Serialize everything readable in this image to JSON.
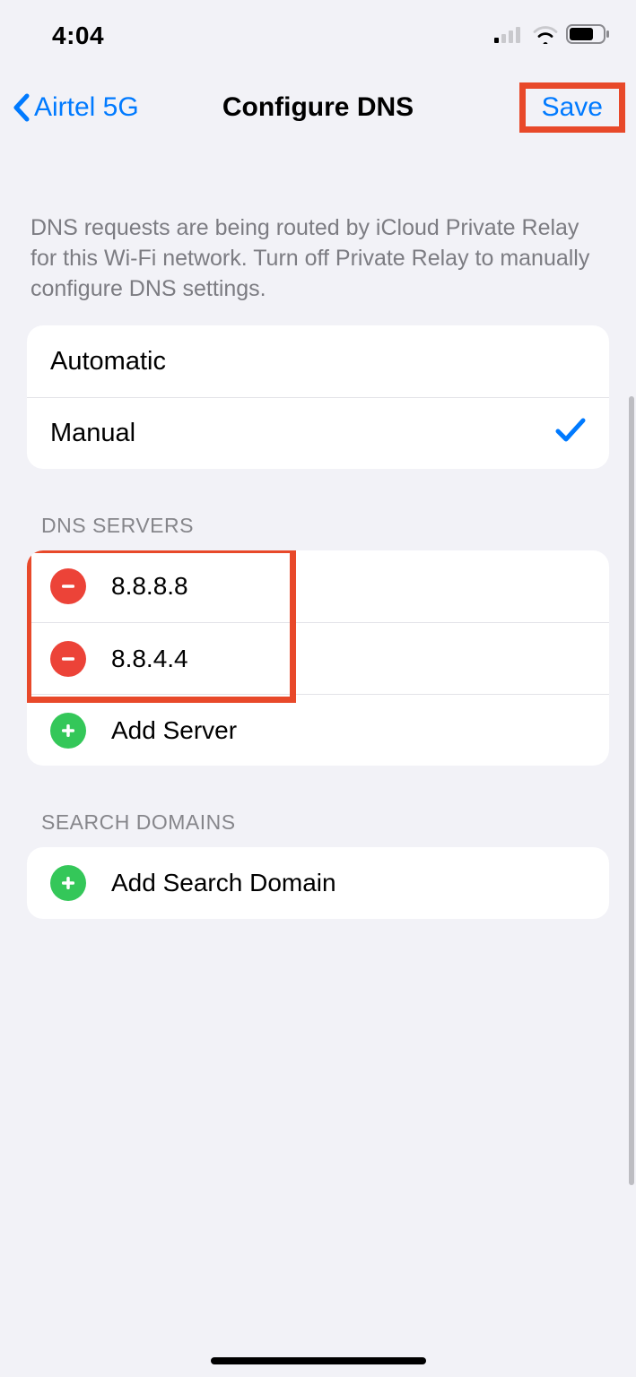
{
  "status": {
    "time": "4:04"
  },
  "nav": {
    "back_label": "Airtel 5G",
    "title": "Configure DNS",
    "save_label": "Save"
  },
  "info": "DNS requests are being routed by iCloud Private Relay for this Wi-Fi network. Turn off Private Relay to manually configure DNS settings.",
  "mode": {
    "automatic_label": "Automatic",
    "manual_label": "Manual",
    "selected": "Manual"
  },
  "dns_servers": {
    "header": "DNS SERVERS",
    "items": [
      {
        "value": "8.8.8.8"
      },
      {
        "value": "8.8.4.4"
      }
    ],
    "add_label": "Add Server"
  },
  "search_domains": {
    "header": "SEARCH DOMAINS",
    "add_label": "Add Search Domain"
  }
}
